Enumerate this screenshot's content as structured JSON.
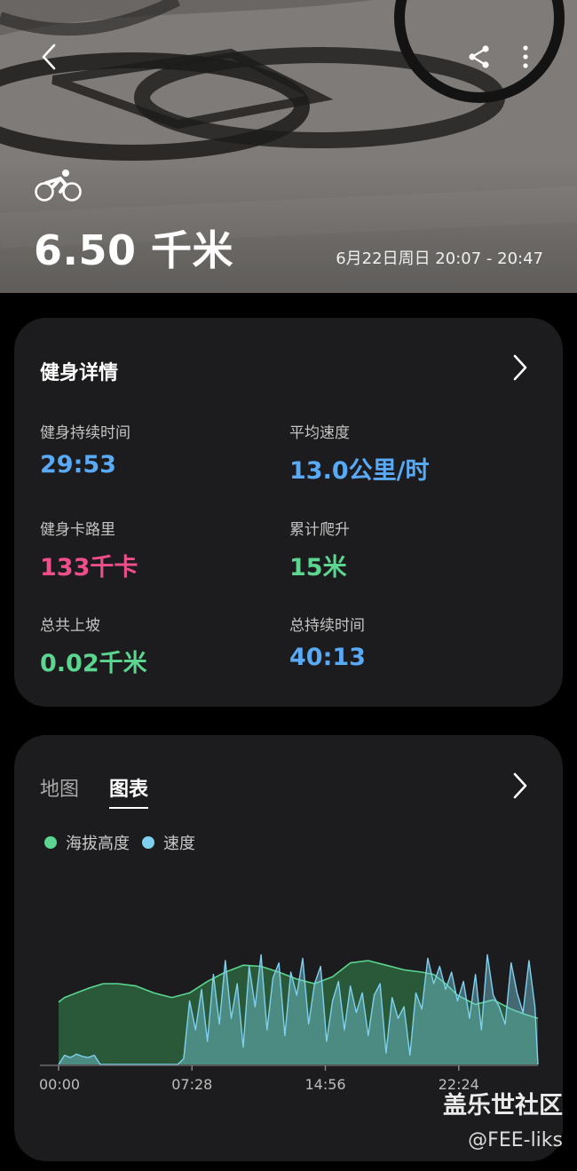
{
  "header": {
    "distance": "6.50 千米",
    "datetime": "6月22日周日 20:07 - 20:47",
    "icons": {
      "back": "chevron-left-icon",
      "share": "share-icon",
      "more": "more-vertical-icon",
      "activity": "cycling-icon"
    }
  },
  "details": {
    "title": "健身详情",
    "stats": [
      {
        "label": "健身持续时间",
        "value": "29:53",
        "color": "#5aa9f5"
      },
      {
        "label": "平均速度",
        "value": "13.0公里/时",
        "color": "#5aa9f5"
      },
      {
        "label": "健身卡路里",
        "value": "133千卡",
        "color": "#ee4e89"
      },
      {
        "label": "累计爬升",
        "value": "15米",
        "color": "#5bd58f"
      },
      {
        "label": "总共上坡",
        "value": "0.02千米",
        "color": "#5bd58f"
      },
      {
        "label": "总持续时间",
        "value": "40:13",
        "color": "#5aa9f5"
      }
    ]
  },
  "chart_card": {
    "tabs": [
      {
        "label": "地图",
        "active": false
      },
      {
        "label": "图表",
        "active": true
      }
    ],
    "legend": [
      {
        "label": "海拔高度",
        "color": "#5bd58f"
      },
      {
        "label": "速度",
        "color": "#7fd0ee"
      }
    ]
  },
  "chart_data": {
    "type": "area",
    "xtick_labels": [
      "00:00",
      "07:28",
      "14:56",
      "22:24"
    ],
    "xtick_values": [
      0,
      448,
      896,
      1344
    ],
    "x_range": [
      0,
      1610
    ],
    "series": [
      {
        "name": "海拔高度",
        "color": "#5bd58f",
        "x": [
          0,
          20,
          60,
          100,
          150,
          200,
          260,
          320,
          380,
          440,
          500,
          560,
          620,
          680,
          740,
          800,
          860,
          920,
          980,
          1040,
          1100,
          1160,
          1220,
          1260,
          1300,
          1340,
          1400,
          1460,
          1520,
          1560,
          1610
        ],
        "values": [
          0.54,
          0.58,
          0.62,
          0.66,
          0.7,
          0.7,
          0.68,
          0.62,
          0.58,
          0.62,
          0.72,
          0.8,
          0.86,
          0.85,
          0.8,
          0.74,
          0.7,
          0.76,
          0.88,
          0.9,
          0.86,
          0.82,
          0.8,
          0.78,
          0.7,
          0.6,
          0.52,
          0.56,
          0.48,
          0.44,
          0.4
        ]
      },
      {
        "name": "速度",
        "color": "#7fd0ee",
        "x": [
          0,
          20,
          40,
          60,
          80,
          100,
          120,
          140,
          160,
          180,
          200,
          220,
          240,
          260,
          280,
          300,
          320,
          340,
          360,
          380,
          400,
          420,
          440,
          460,
          480,
          500,
          520,
          540,
          560,
          580,
          600,
          620,
          640,
          660,
          680,
          700,
          720,
          740,
          760,
          780,
          800,
          820,
          840,
          860,
          880,
          900,
          920,
          940,
          960,
          980,
          1000,
          1020,
          1040,
          1060,
          1080,
          1100,
          1120,
          1140,
          1160,
          1180,
          1200,
          1220,
          1240,
          1260,
          1280,
          1300,
          1320,
          1340,
          1360,
          1380,
          1400,
          1420,
          1440,
          1460,
          1480,
          1500,
          1520,
          1540,
          1560,
          1580,
          1600,
          1610
        ],
        "values": [
          0.0,
          0.08,
          0.06,
          0.09,
          0.07,
          0.06,
          0.08,
          0.0,
          0.0,
          0.0,
          0.0,
          0.0,
          0.0,
          0.0,
          0.0,
          0.0,
          0.0,
          0.0,
          0.0,
          0.0,
          0.0,
          0.05,
          0.55,
          0.3,
          0.65,
          0.2,
          0.78,
          0.35,
          0.9,
          0.4,
          0.7,
          0.15,
          0.85,
          0.5,
          0.95,
          0.3,
          0.75,
          0.88,
          0.25,
          0.8,
          0.6,
          0.92,
          0.35,
          0.7,
          0.85,
          0.2,
          0.55,
          0.72,
          0.3,
          0.68,
          0.45,
          0.62,
          0.25,
          0.6,
          0.7,
          0.1,
          0.58,
          0.4,
          0.5,
          0.08,
          0.62,
          0.48,
          0.92,
          0.7,
          0.85,
          0.65,
          0.8,
          0.55,
          0.72,
          0.4,
          0.78,
          0.3,
          0.95,
          0.6,
          0.5,
          0.35,
          0.88,
          0.62,
          0.45,
          0.9,
          0.5,
          0.0
        ]
      }
    ]
  },
  "watermark": {
    "title": "盖乐世社区",
    "handle": "@FEE-liks"
  }
}
